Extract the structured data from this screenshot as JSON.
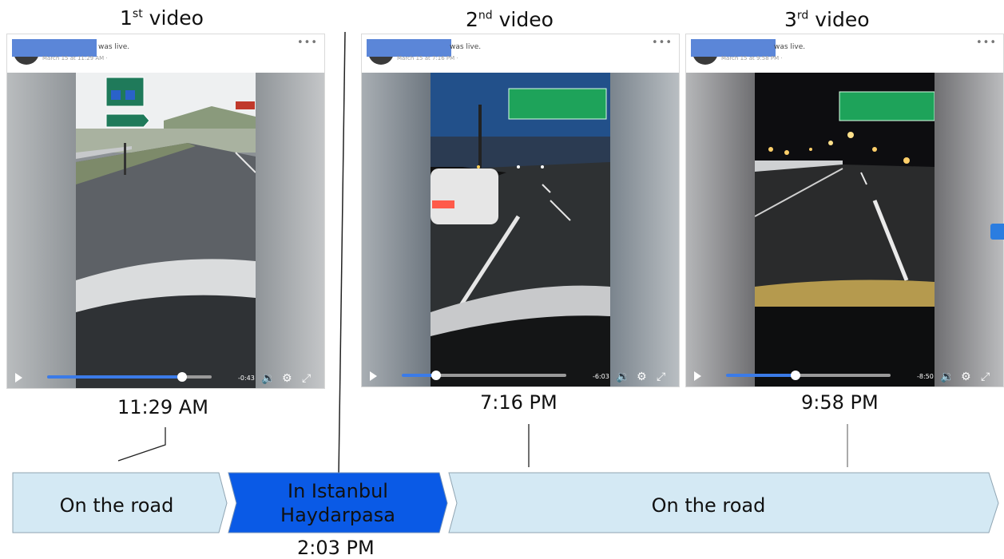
{
  "titles": [
    {
      "num": "1",
      "sup": "st",
      "word": "video"
    },
    {
      "num": "2",
      "sup": "nd",
      "word": "video"
    },
    {
      "num": "3",
      "sup": "rd",
      "word": "video"
    }
  ],
  "posts": [
    {
      "live": "was live.",
      "date": "March 15 at 11:29 AM ·",
      "remaining": "-0:43",
      "progress": 0.82
    },
    {
      "live": "was live.",
      "date": "March 15 at 7:16 PM ·",
      "remaining": "-6:03",
      "progress": 0.21
    },
    {
      "live": "was live.",
      "date": "March 15 at 9:58 PM ·",
      "remaining": "-8:50",
      "progress": 0.42
    }
  ],
  "times": {
    "first": "11:29 AM",
    "second": "7:16 PM",
    "third": "9:58 PM",
    "istanbul": "2:03 PM"
  },
  "timeline": {
    "seg1": "On the road",
    "seg2_line1": "In Istanbul",
    "seg2_line2": "Haydarpasa",
    "seg3": "On the road"
  },
  "colors": {
    "segment_light": "#d4e9f4",
    "segment_highlight": "#0a5ae6",
    "progress": "#3b7be8",
    "redaction": "#5b86d8"
  }
}
